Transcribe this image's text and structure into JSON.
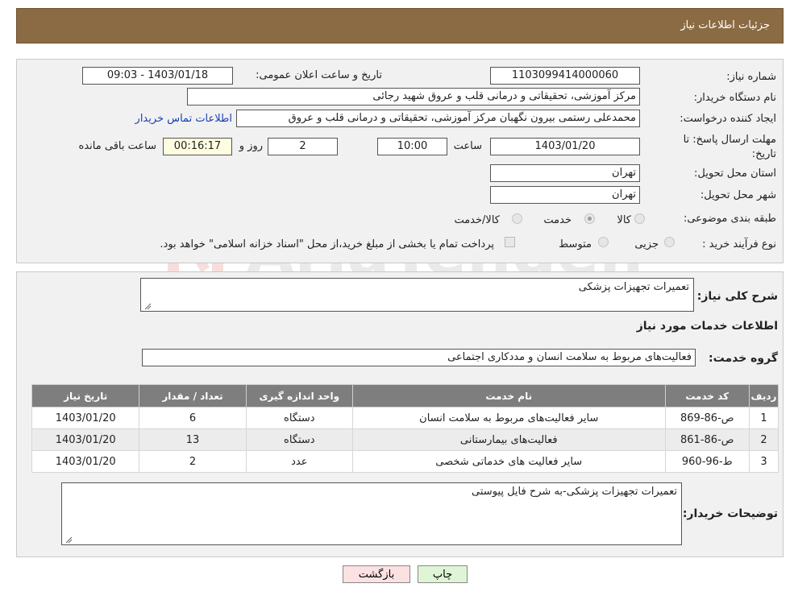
{
  "header": {
    "title": "جزئیات اطلاعات نیاز"
  },
  "form": {
    "need_number_label": "شماره نیاز:",
    "need_number": "1103099414000060",
    "announce_label": "تاریخ و ساعت اعلان عمومی:",
    "announce_value": "1403/01/18 - 09:03",
    "buyer_org_label": "نام دستگاه خریدار:",
    "buyer_org": "مرکز آموزشی، تحقیقاتی و درمانی قلب و عروق شهید رجائی",
    "creator_label": "ایجاد کننده درخواست:",
    "creator": "محمدعلی رستمی بیرون نگهبان مرکز آموزشی، تحقیقاتی و درمانی قلب و عروق",
    "contact_link": "اطلاعات تماس خریدار",
    "deadline_label_1": "مهلت ارسال پاسخ: تا",
    "deadline_label_2": "تاریخ:",
    "deadline_date": "1403/01/20",
    "time_label": "ساعت",
    "deadline_time": "10:00",
    "days_value": "2",
    "days_label": "روز و",
    "remaining_time": "00:16:17",
    "remaining_label": "ساعت باقی مانده",
    "province_label": "استان محل تحویل:",
    "province": "تهران",
    "city_label": "شهر محل تحویل:",
    "city": "تهران",
    "category_label": "طبقه بندی موضوعی:",
    "category_options": [
      "کالا",
      "خدمت",
      "کالا/خدمت"
    ],
    "category_selected": "خدمت",
    "purchase_type_label": "نوع فرآیند خرید :",
    "purchase_options": [
      "جزیی",
      "متوسط"
    ],
    "payment_note": "پرداخت تمام یا بخشی از مبلغ خرید،از محل \"اسناد خزانه اسلامی\" خواهد بود."
  },
  "details": {
    "summary_label": "شرح کلی نیاز:",
    "summary": "تعمیرات تجهیزات پزشکی",
    "services_heading": "اطلاعات خدمات مورد نیاز",
    "service_group_label": "گروه خدمت:",
    "service_group": "فعالیت‌های مربوط به سلامت انسان و مددکاری اجتماعی",
    "table": {
      "headers": [
        "ردیف",
        "کد خدمت",
        "نام خدمت",
        "واحد اندازه گیری",
        "تعداد / مقدار",
        "تاریخ نیاز"
      ],
      "rows": [
        [
          "1",
          "ص-86-869",
          "سایر فعالیت‌های مربوط به سلامت انسان",
          "دستگاه",
          "6",
          "1403/01/20"
        ],
        [
          "2",
          "ص-86-861",
          "فعالیت‌های بیمارستانی",
          "دستگاه",
          "13",
          "1403/01/20"
        ],
        [
          "3",
          "ط-96-960",
          "سایر فعالیت های خدماتی شخصی",
          "عدد",
          "2",
          "1403/01/20"
        ]
      ]
    },
    "buyer_notes_label": "توضیحات خریدار:",
    "buyer_notes": "تعمیرات تجهیزات پزشکی-به شرح فایل پیوستی"
  },
  "buttons": {
    "print": "چاپ",
    "back": "بازگشت"
  },
  "watermark_text": "AriaTender.net",
  "colors": {
    "header_bg": "#8b6b43",
    "print_bg": "#dff5d6",
    "back_bg": "#fbe1e1",
    "link": "#1a3fb8"
  }
}
